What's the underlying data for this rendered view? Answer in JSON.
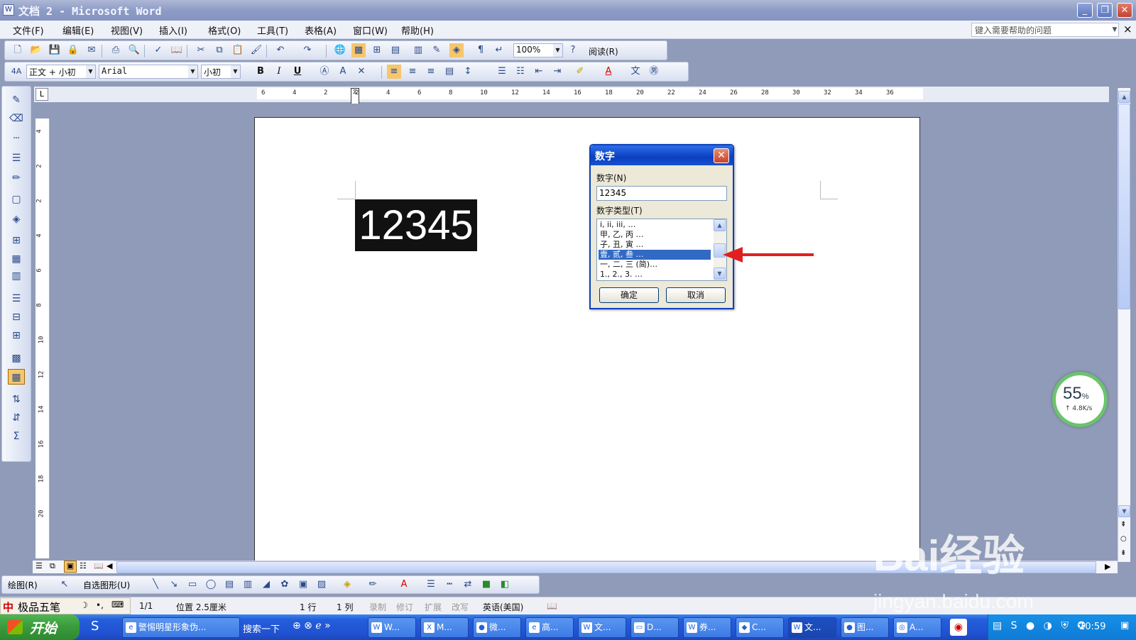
{
  "window": {
    "title": "文档 2 - Microsoft Word",
    "app_icon": "W"
  },
  "menu": {
    "items": [
      "文件(F)",
      "编辑(E)",
      "视图(V)",
      "插入(I)",
      "格式(O)",
      "工具(T)",
      "表格(A)",
      "窗口(W)",
      "帮助(H)"
    ],
    "help_placeholder": "键入需要帮助的问题",
    "close_x": "×"
  },
  "toolbar_standard": {
    "zoom": "100%",
    "read_label": "阅读(R)"
  },
  "toolbar_format": {
    "style": "正文 + 小初",
    "font": "Arial",
    "size": "小初",
    "bold": "B",
    "italic": "I",
    "underline": "U",
    "style_icon": "4A"
  },
  "ruler": {
    "h_ticks": [
      "6",
      "4",
      "2",
      "2",
      "4",
      "6",
      "8",
      "10",
      "12",
      "14",
      "16",
      "18",
      "20",
      "22",
      "24",
      "26",
      "28",
      "30",
      "32",
      "34",
      "36"
    ],
    "v_ticks": [
      "4",
      "2",
      "2",
      "4",
      "6",
      "8",
      "10",
      "12",
      "14",
      "16",
      "18",
      "20"
    ],
    "corner": "L"
  },
  "document": {
    "selected_text": "12345"
  },
  "dialog": {
    "title": "数字",
    "number_label": "数字(N)",
    "number_value": "12345",
    "type_label": "数字类型(T)",
    "list_items": [
      "i, ii, iii, …",
      "甲, 乙, 丙 …",
      "子, 丑, 寅 …",
      "壹, 贰, 叁 …",
      "一, 二, 三 (简)…",
      "1., 2., 3. …"
    ],
    "selected_index": 3,
    "ok": "确定",
    "cancel": "取消"
  },
  "speed_widget": {
    "percent": "55",
    "unit": "%",
    "rate": "↑ 4.8K/s"
  },
  "draw_toolbar": {
    "draw": "绘图(R)",
    "autoshapes": "自选图形(U)"
  },
  "statusbar": {
    "ime": "极品五笔",
    "page": "1/1",
    "position": "位置 2.5厘米",
    "line": "1 行",
    "col": "1 列",
    "rec": "录制",
    "trk": "修订",
    "ext": "扩展",
    "ovr": "改写",
    "lang": "英语(美国)"
  },
  "taskbar": {
    "start": "开始",
    "tasks": [
      "警惕明星形象伪...",
      "搜索一下",
      "W...",
      "M...",
      "微...",
      "高...",
      "文...",
      "D...",
      "券...",
      "C...",
      "文...",
      "图...",
      "A..."
    ],
    "clock": "10:59"
  },
  "watermark": {
    "brand": "Bai经验",
    "url": "jingyan.baidu.com"
  },
  "colors": {
    "title_bar": "#8d9cc6",
    "dialog_title": "#0a3fbf",
    "selection": "#316ac5",
    "arrow": "#e02020",
    "taskbar": "#245edb",
    "start": "#3a9a3c"
  }
}
